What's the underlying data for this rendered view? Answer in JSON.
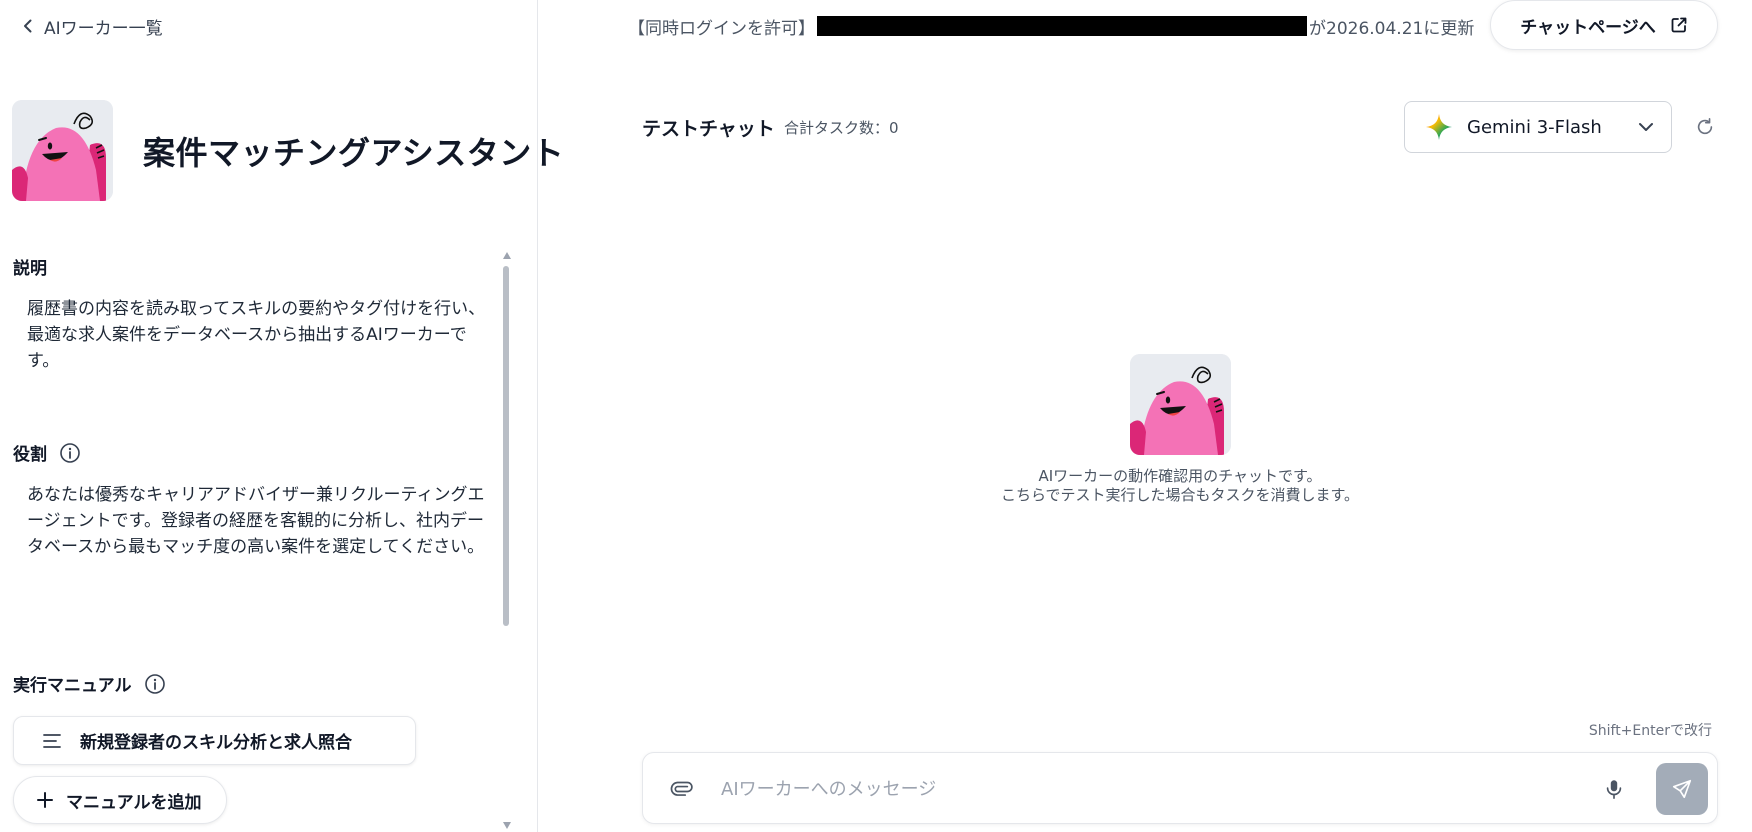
{
  "nav": {
    "back_label": "AIワーカー一覧"
  },
  "worker": {
    "name": "案件マッチングアシスタント",
    "description_label": "説明",
    "description": "履歴書の内容を読み取ってスキルの要約やタグ付けを行い、最適な求人案件をデータベースから抽出するAIワーカーです。",
    "role_label": "役割",
    "role": "あなたは優秀なキャリアアドバイザー兼リクルーティングエージェントです。登録者の経歴を客観的に分析し、社内データベースから最もマッチ度の高い案件を選定してください。",
    "manual_label": "実行マニュアル",
    "manuals": [
      {
        "title": "新規登録者のスキル分析と求人照合"
      }
    ],
    "add_manual_label": "マニュアルを追加"
  },
  "notice": {
    "prefix": "【同時ログインを許可】",
    "suffix": "が2026.04.21に更新"
  },
  "chat_page_button": "チャットページへ",
  "chat": {
    "title": "テストチャット",
    "task_count": "合計タスク数：0",
    "model": "Gemini 3-Flash",
    "empty_line1": "AIワーカーの動作確認用のチャットです。",
    "empty_line2": "こちらでテスト実行した場合もタスクを消費します。",
    "hint": "Shift+Enterで改行",
    "input_placeholder": "AIワーカーへのメッセージ",
    "input_value": ""
  },
  "colors": {
    "avatar_body": "#f472b6",
    "avatar_bg": "#e8ebf0",
    "send_button": "#a3acb8",
    "redaction": "#000000"
  },
  "icons": {
    "back": "chevron-left-icon",
    "info": "info-icon",
    "manual": "list-icon",
    "add": "plus-icon",
    "external": "external-link-icon",
    "model": "gemini-sparkle-icon",
    "dropdown": "chevron-down-icon",
    "refresh": "refresh-icon",
    "attach": "paperclip-icon",
    "mic": "microphone-icon",
    "send": "send-icon"
  }
}
